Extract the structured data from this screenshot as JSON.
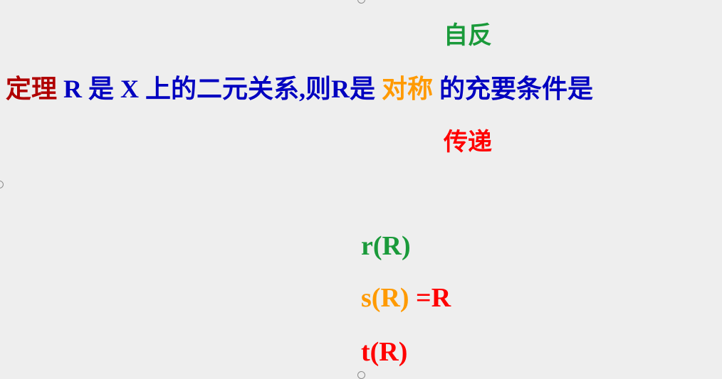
{
  "theorem": {
    "label": "定理",
    "intro": "R 是 X 上的二元关系,则R是",
    "options": {
      "reflexive": "自反",
      "symmetric": "对称",
      "transitive": "传递"
    },
    "tail": "的充要条件是"
  },
  "formulas": {
    "r": "r(R)",
    "s": "s(R)",
    "eq": "=R",
    "t": "t(R)"
  },
  "colors": {
    "label": "#b00000",
    "body": "#0000c0",
    "reflexive": "#1a9a3a",
    "symmetric": "#ff9a00",
    "transitive": "#ff0000"
  }
}
